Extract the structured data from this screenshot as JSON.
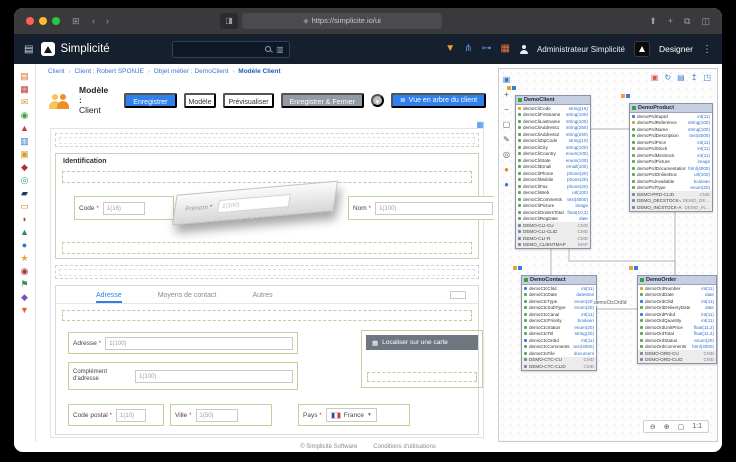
{
  "colors": {
    "accent": "#2f80ed",
    "header_bg": "#151f2d",
    "zone_green": "#bdd39a",
    "entity_header": "#c6cfe2"
  },
  "browser": {
    "url": "https://simplicite.io/ui"
  },
  "header": {
    "brand": "Simplicité",
    "search_placeholder": "",
    "icons": [
      {
        "name": "filter",
        "glyph": "▼"
      },
      {
        "name": "sitemap",
        "glyph": "⋔"
      },
      {
        "name": "share",
        "glyph": "⊶"
      },
      {
        "name": "apps-grid",
        "glyph": "▦"
      }
    ],
    "user": "Administrateur Simplicité",
    "role": "Designer"
  },
  "breadcrumb": {
    "separator": "›",
    "items": [
      "Client",
      "Client : Robert SPONJE",
      "Objet métier : DemoClient",
      "Modèle Client"
    ]
  },
  "toolbar": {
    "title_prefix": "Modèle :",
    "title_object": "Client",
    "save": "Enregistrer",
    "model": "Modèle",
    "preview": "Prévisualiser",
    "save_close": "Enregistrer & Fermer",
    "more": "▾",
    "tree_view": "Vue en arbre du client",
    "tree_icon": "≣",
    "grid_icon": "▦"
  },
  "form": {
    "required": "*",
    "identification": {
      "title": "Identification",
      "code_label": "Code",
      "code_ph": "1(16)",
      "drag_label": "Prénom",
      "drag_ph": "1(100)",
      "nom_label": "Nom",
      "nom_ph": "1(100)"
    },
    "tabs": [
      "Adresse",
      "Moyens de contact",
      "Autres"
    ],
    "adresse": {
      "adresse_label": "Adresse",
      "adresse_ph": "1(100)",
      "comp_label": "Complément d'adresse",
      "comp_ph": "1(100)",
      "cp_label": "Code postal",
      "cp_ph": "1(10)",
      "ville_label": "Ville",
      "ville_ph": "1(50)",
      "pays_label": "Pays",
      "pays_value": "France",
      "map_button": "Localiser sur une carte",
      "map_icon": "▦"
    }
  },
  "footer": {
    "copyright": "© Simplicité Software",
    "terms": "Conditions d'utilisations"
  },
  "rail": {
    "items": [
      {
        "name": "home",
        "glyph": "▤",
        "color": "#d86a2b"
      },
      {
        "name": "calendar",
        "glyph": "▦",
        "color": "#c23a3a"
      },
      {
        "name": "mail",
        "glyph": "✉",
        "color": "#d89b2b"
      },
      {
        "name": "check",
        "glyph": "◉",
        "color": "#3f9e3f"
      },
      {
        "name": "alert",
        "glyph": "▲",
        "color": "#c23a3a"
      },
      {
        "name": "document",
        "glyph": "▥",
        "color": "#3a6fd8"
      },
      {
        "name": "box",
        "glyph": "▣",
        "color": "#d89b2b"
      },
      {
        "name": "tag",
        "glyph": "◆",
        "color": "#b03030"
      },
      {
        "name": "globe",
        "glyph": "◎",
        "color": "#2aa198"
      },
      {
        "name": "shield",
        "glyph": "▰",
        "color": "#1a3a6b"
      },
      {
        "name": "cart",
        "glyph": "▭",
        "color": "#e07b39"
      },
      {
        "name": "heart",
        "glyph": "◗",
        "color": "#cc3333"
      },
      {
        "name": "leaf",
        "glyph": "▲",
        "color": "#2e8b57"
      },
      {
        "name": "drop",
        "glyph": "●",
        "color": "#3a6fd8"
      },
      {
        "name": "star",
        "glyph": "★",
        "color": "#e8a23a"
      },
      {
        "name": "pin",
        "glyph": "◉",
        "color": "#aa3333"
      },
      {
        "name": "flag",
        "glyph": "⚑",
        "color": "#2e8b57"
      },
      {
        "name": "gem",
        "glyph": "◆",
        "color": "#7b52ab"
      },
      {
        "name": "tools",
        "glyph": "▼",
        "color": "#d86a2b"
      }
    ]
  },
  "diagram": {
    "toolbar": [
      {
        "name": "save",
        "glyph": "▣",
        "color": "#d9534f"
      },
      {
        "name": "refresh",
        "glyph": "↻",
        "color": "#3a7bd5"
      },
      {
        "name": "print",
        "glyph": "▤",
        "color": "#3a7bd5"
      },
      {
        "name": "export",
        "glyph": "↥",
        "color": "#3a7bd5"
      },
      {
        "name": "open-window",
        "glyph": "◳",
        "color": "#3a7bd5"
      }
    ],
    "side_toolbar": [
      {
        "name": "select-tool",
        "glyph": "▣",
        "color": "#3a7bd5"
      },
      {
        "name": "zoom-in-tool",
        "glyph": "+",
        "color": "#5a5a5a"
      },
      {
        "name": "zoom-out-tool",
        "glyph": "−",
        "color": "#5a5a5a"
      },
      {
        "name": "shape-tool",
        "glyph": "▢",
        "color": "#5a5a5a"
      },
      {
        "name": "edit-tool",
        "glyph": "✎",
        "color": "#5a5a5a"
      },
      {
        "name": "target-tool",
        "glyph": "◎",
        "color": "#5a5a5a"
      },
      {
        "name": "color-orange",
        "glyph": "●",
        "color": "#e8872a"
      },
      {
        "name": "color-blue",
        "glyph": "●",
        "color": "#3a7bd5"
      }
    ],
    "zoom": {
      "out": "⊖",
      "in": "⊕",
      "fit": "▢",
      "level": "1:1"
    },
    "links": [
      {
        "label": "demoCtcOrdId"
      }
    ],
    "entities": {
      "client": {
        "title": "DemoClient",
        "fields": [
          {
            "n": "demoCliCode",
            "t": "string(16)",
            "c": "#d9a520"
          },
          {
            "n": "demoCliFirstname",
            "t": "string(100)",
            "c": "#5aa85a"
          },
          {
            "n": "demoCliLastname",
            "t": "string(100)",
            "c": "#5aa85a"
          },
          {
            "n": "demoCliAddress1",
            "t": "string(250)",
            "c": "#5aa85a"
          },
          {
            "n": "demoCliAddress2",
            "t": "string(250)",
            "c": "#5aa85a"
          },
          {
            "n": "demoCliZipCode",
            "t": "string(10)",
            "c": "#5aa85a"
          },
          {
            "n": "demoCliCity",
            "t": "string(100)",
            "c": "#5aa85a"
          },
          {
            "n": "demoCliCountry",
            "t": "enum(100)",
            "c": "#5aa85a"
          },
          {
            "n": "demoCliState",
            "t": "enum(100)",
            "c": "#5aa85a"
          },
          {
            "n": "demoCliEmail",
            "t": "email(100)",
            "c": "#5aa85a"
          },
          {
            "n": "demoCliPhone",
            "t": "phone(20)",
            "c": "#5aa85a"
          },
          {
            "n": "demoCliMobile",
            "t": "phone(20)",
            "c": "#5aa85a"
          },
          {
            "n": "demoCliFax",
            "t": "phone(20)",
            "c": "#5aa85a"
          },
          {
            "n": "demoCliWeb",
            "t": "url(100)",
            "c": "#5aa85a"
          },
          {
            "n": "demoCliComments",
            "t": "text(4000)",
            "c": "#5aa85a"
          },
          {
            "n": "demoCliPicture",
            "t": "image",
            "c": "#5aa85a"
          },
          {
            "n": "demoCliOrdersTotal",
            "t": "float(10,2)",
            "c": "#5aa85a"
          },
          {
            "n": "demoCliRegDate",
            "t": "date",
            "c": "#5aa85a"
          }
        ],
        "actions": [
          {
            "n": "DEMO-CLI-CU",
            "t": "CMD"
          },
          {
            "n": "DEMO-CLI-CLID",
            "t": "CMD"
          },
          {
            "n": "DEMO-CLI-R",
            "t": "CMD"
          },
          {
            "n": "DEMO_CLIENTMAP",
            "t": "MAP"
          }
        ]
      },
      "product": {
        "title": "DemoProduct",
        "fields": [
          {
            "n": "demoPrdSupId",
            "t": "int(11)",
            "c": "#3a7bd5"
          },
          {
            "n": "demoPrdReference",
            "t": "string(100)",
            "c": "#d9a520"
          },
          {
            "n": "demoPrdName",
            "t": "string(100)",
            "c": "#5aa85a"
          },
          {
            "n": "demoPrdDescription",
            "t": "text(4000)",
            "c": "#5aa85a"
          },
          {
            "n": "demoPrdPrice",
            "t": "int(11)",
            "c": "#5aa85a"
          },
          {
            "n": "demoPrdStock",
            "t": "int(11)",
            "c": "#5aa85a"
          },
          {
            "n": "demoPrdMinStock",
            "t": "int(11)",
            "c": "#5aa85a"
          },
          {
            "n": "demoPrdPicture",
            "t": "image",
            "c": "#5aa85a"
          },
          {
            "n": "demoPrdDocumentation",
            "t": "html(4000)",
            "c": "#5aa85a"
          },
          {
            "n": "demoPrdOnlineDoc",
            "t": "url(100)",
            "c": "#5aa85a"
          },
          {
            "n": "demoPrdAvailable",
            "t": "boolean",
            "c": "#5aa85a"
          },
          {
            "n": "demoPrdType",
            "t": "enum(20)",
            "c": "#5aa85a"
          }
        ],
        "actions": [
          {
            "n": "DEMO-PRD-CLID",
            "t": "CMD"
          },
          {
            "n": "DEMO_DECSTOCK-A",
            "t": "DEMO_DE…"
          },
          {
            "n": "DEMO_INCSTOCK-A",
            "t": "DEMO_IN…"
          }
        ]
      },
      "contact": {
        "title": "DemoContact",
        "fields": [
          {
            "n": "demoCtcCliId",
            "t": "int(11)",
            "c": "#3a7bd5"
          },
          {
            "n": "demoCtcDate",
            "t": "datetime",
            "c": "#5aa85a"
          },
          {
            "n": "demoCtcType",
            "t": "enum(20)",
            "c": "#5aa85a"
          },
          {
            "n": "demoCtcSubType",
            "t": "enum(20)",
            "c": "#5aa85a"
          },
          {
            "n": "demoCtcCanal",
            "t": "int(11)",
            "c": "#5aa85a"
          },
          {
            "n": "demoCtcPriority",
            "t": "boolean",
            "c": "#5aa85a"
          },
          {
            "n": "demoCtcStatus",
            "t": "enum(20)",
            "c": "#5aa85a"
          },
          {
            "n": "demoCtcTel",
            "t": "string(20)",
            "c": "#5aa85a"
          },
          {
            "n": "demoCtcOrdId",
            "t": "int(11)",
            "c": "#3a7bd5"
          },
          {
            "n": "demoCtcComments",
            "t": "text(4000)",
            "c": "#5aa85a"
          },
          {
            "n": "demoCtcFile",
            "t": "document",
            "c": "#5aa85a"
          }
        ],
        "actions": [
          {
            "n": "DEMO-CTC-CU",
            "t": "CMD"
          },
          {
            "n": "DEMO-CTC-CLID",
            "t": "CMD"
          }
        ]
      },
      "order": {
        "title": "DemoOrder",
        "fields": [
          {
            "n": "demoOrdNumber",
            "t": "int(11)",
            "c": "#d9a520"
          },
          {
            "n": "demoOrdDate",
            "t": "date",
            "c": "#5aa85a"
          },
          {
            "n": "demoOrdCliId",
            "t": "int(11)",
            "c": "#3a7bd5"
          },
          {
            "n": "demoOrdDeliveryDate",
            "t": "date",
            "c": "#5aa85a"
          },
          {
            "n": "demoOrdPrdId",
            "t": "int(11)",
            "c": "#3a7bd5"
          },
          {
            "n": "demoOrdQuantity",
            "t": "int(11)",
            "c": "#5aa85a"
          },
          {
            "n": "demoOrdUnitPrice",
            "t": "float(11,2)",
            "c": "#5aa85a"
          },
          {
            "n": "demoOrdTotal",
            "t": "float(11,2)",
            "c": "#5aa85a"
          },
          {
            "n": "demoOrdStatus",
            "t": "enum(20)",
            "c": "#5aa85a"
          },
          {
            "n": "demoOrdComments",
            "t": "html(4000)",
            "c": "#5aa85a"
          }
        ],
        "actions": [
          {
            "n": "DEMO-ORD-CU",
            "t": "CMD"
          },
          {
            "n": "DEMO-ORD-CLID",
            "t": "CMD"
          }
        ]
      }
    }
  }
}
